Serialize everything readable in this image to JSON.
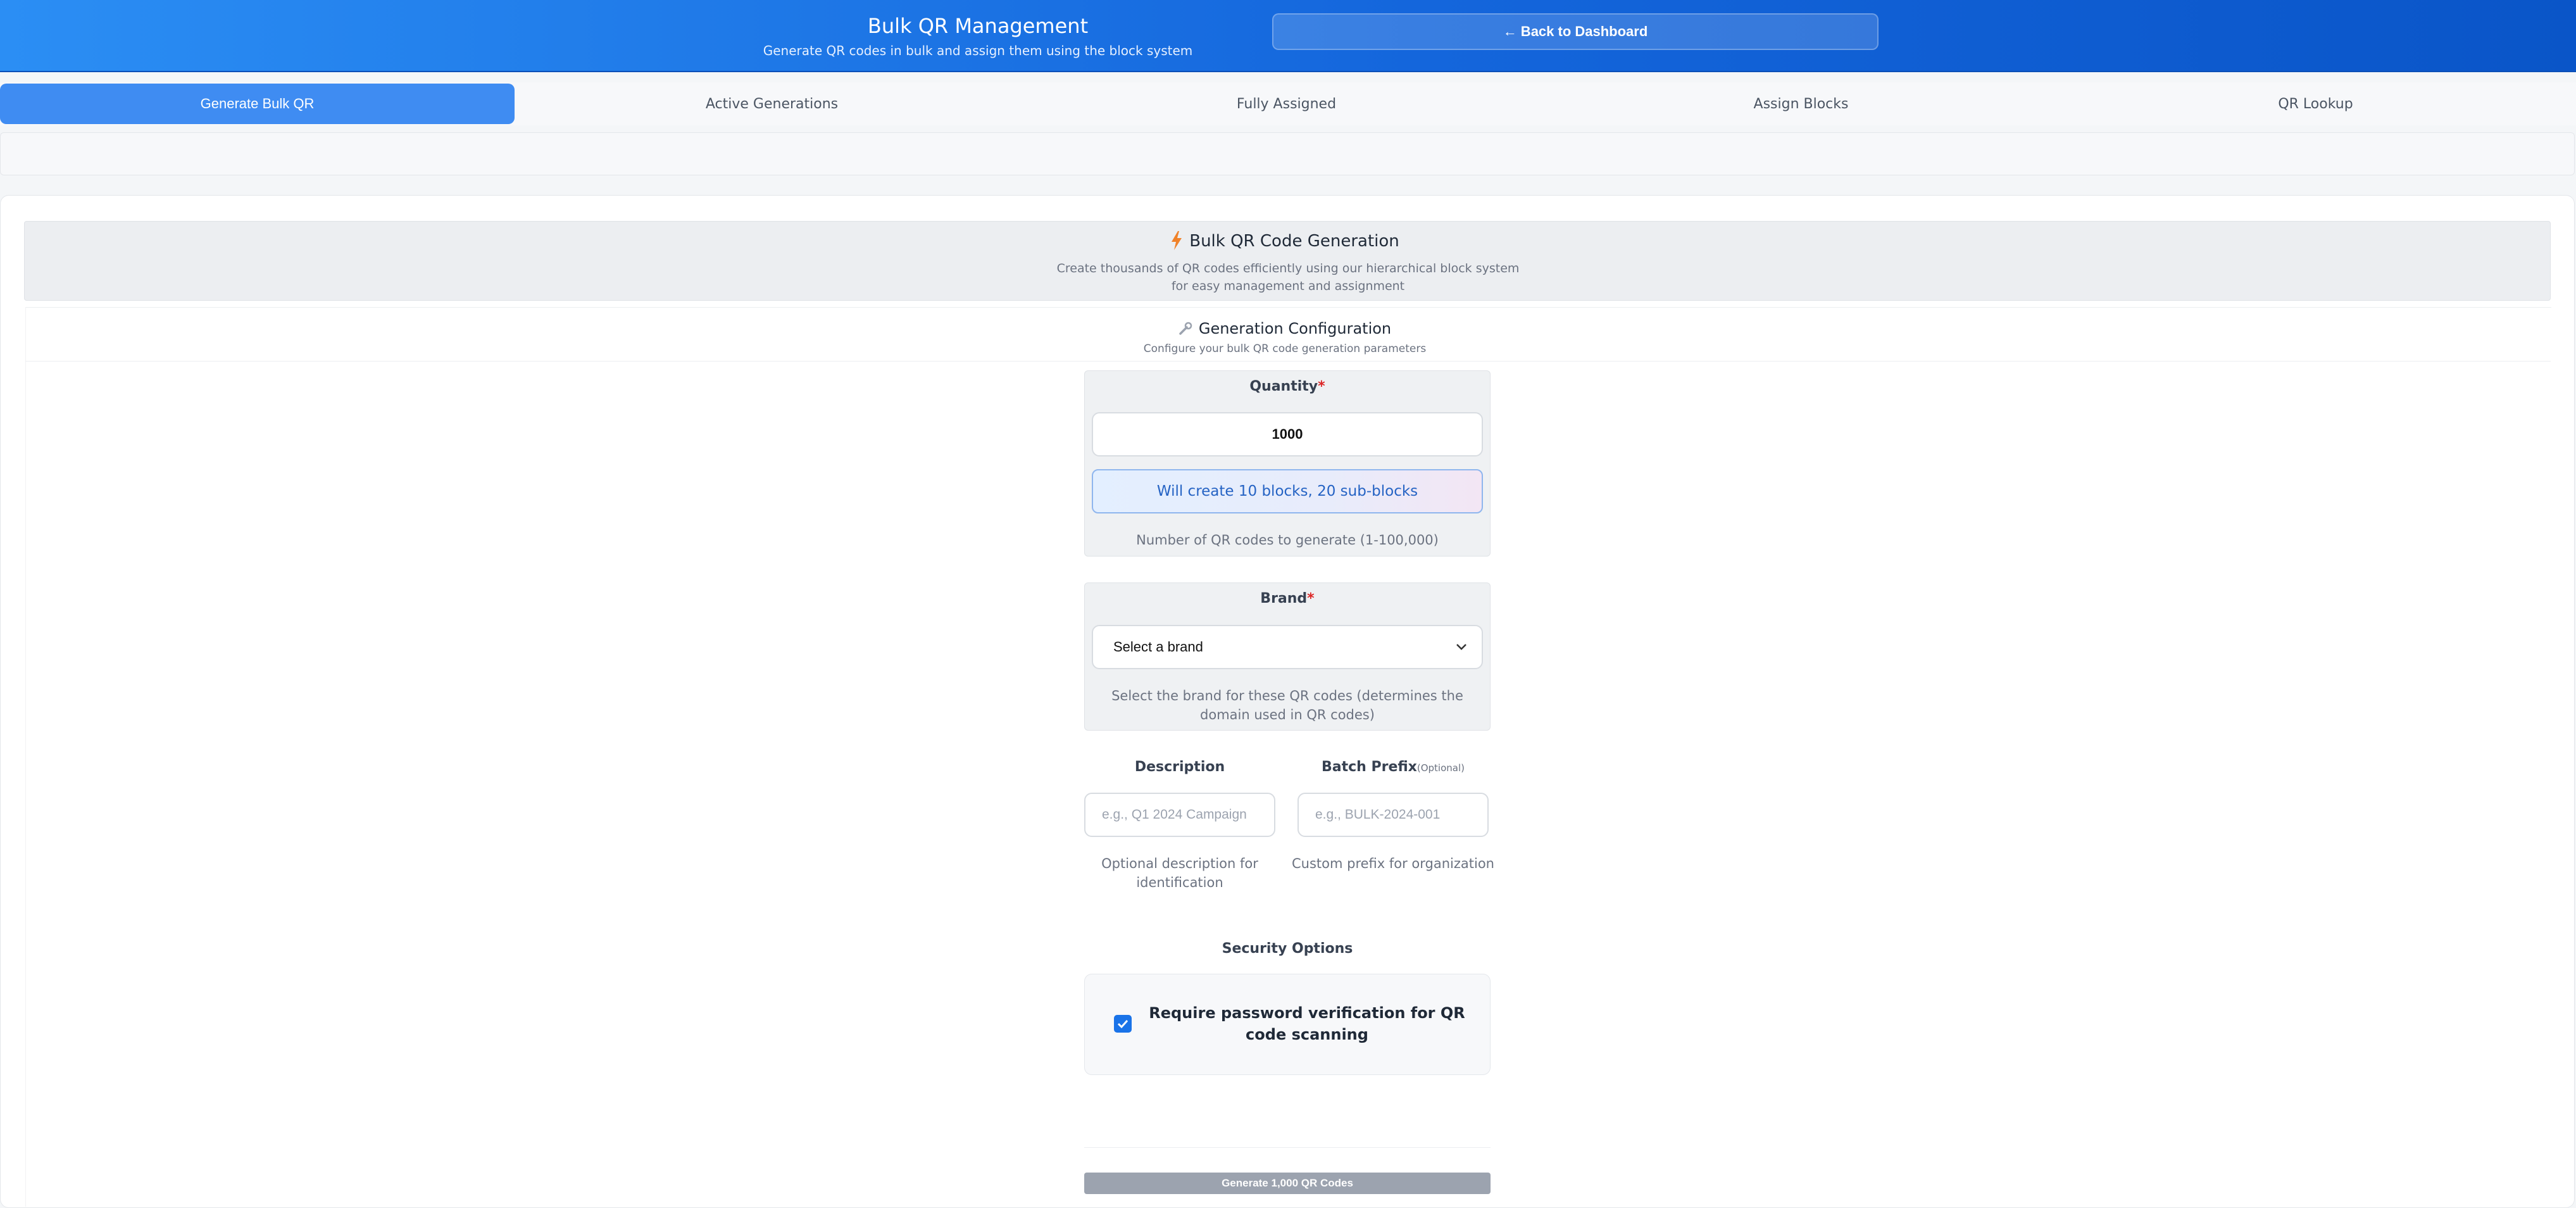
{
  "header": {
    "title": "Bulk QR Management",
    "subtitle": "Generate QR codes in bulk and assign them using the block system",
    "back_label": "← Back to Dashboard"
  },
  "tabs": [
    {
      "label": "Generate Bulk QR",
      "active": true
    },
    {
      "label": "Active Generations",
      "active": false
    },
    {
      "label": "Fully Assigned",
      "active": false
    },
    {
      "label": "Assign Blocks",
      "active": false
    },
    {
      "label": "QR Lookup",
      "active": false
    }
  ],
  "hero": {
    "icon": "lightning-bolt-icon",
    "title": "Bulk QR Code Generation",
    "description": "Create thousands of QR codes efficiently using our hierarchical block system for easy management and assignment"
  },
  "config": {
    "icon": "wrench-icon",
    "title": "Generation Configuration",
    "subtitle": "Configure your bulk QR code generation parameters"
  },
  "quantity": {
    "label": "Quantity",
    "required_mark": "*",
    "value": "1000",
    "info": "Will create 10 blocks, 20 sub-blocks",
    "help": "Number of QR codes to generate (1-100,000)"
  },
  "brand": {
    "label": "Brand",
    "required_mark": "*",
    "selected": "Select a brand",
    "help": "Select the brand for these QR codes (determines the domain used in QR codes)"
  },
  "description": {
    "label": "Description",
    "placeholder": "e.g., Q1 2024 Campaign",
    "help": "Optional description for identification"
  },
  "batch_prefix": {
    "label": "Batch Prefix",
    "optional": "(Optional)",
    "placeholder": "e.g., BULK-2024-001",
    "help": "Custom prefix for organization"
  },
  "security": {
    "title": "Security Options",
    "checkbox_label": "Require password verification for QR code scanning",
    "checked": true
  },
  "generate_label": "Generate 1,000 QR Codes",
  "colors": {
    "header_start": "#2b8ef4",
    "header_end": "#0a55c8",
    "active_tab": "#3f8cf2",
    "required": "#dc2626",
    "info_text": "#2563c4",
    "checkbox": "#1a73e8",
    "disabled_button": "#9ca3af"
  }
}
